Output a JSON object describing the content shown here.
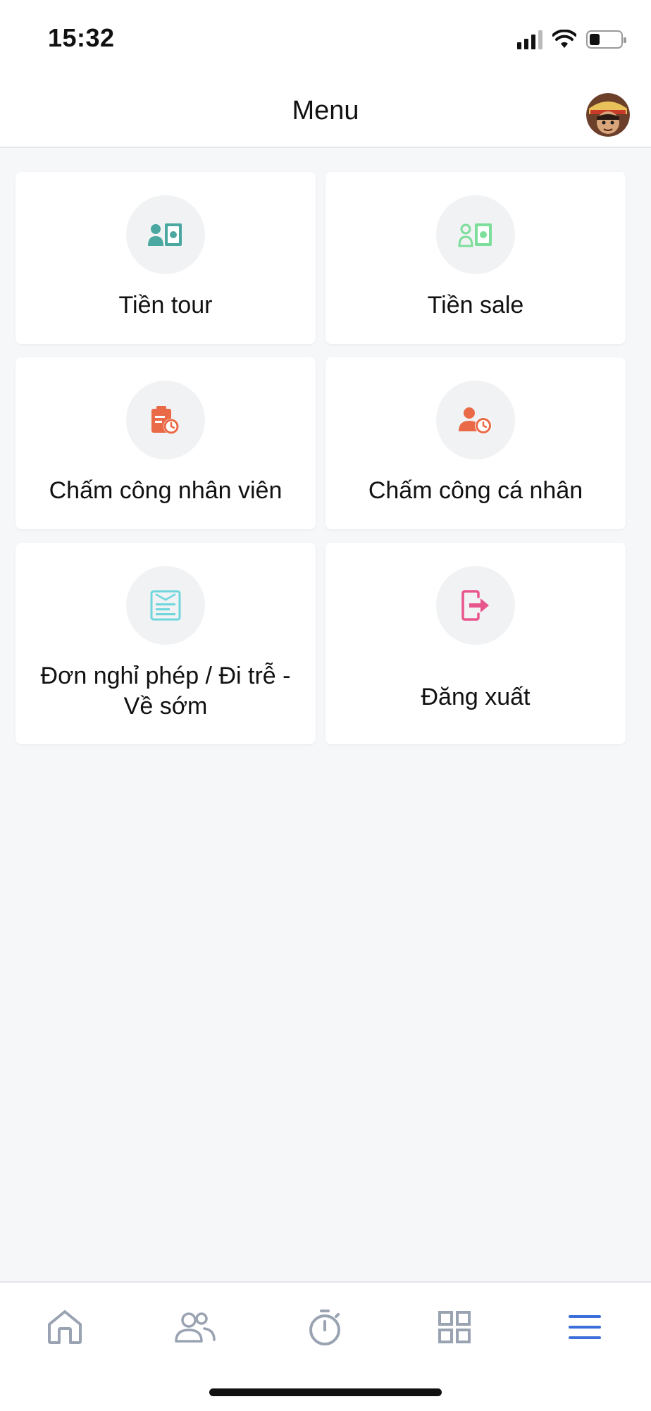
{
  "status_bar": {
    "time": "15:32"
  },
  "header": {
    "title": "Menu"
  },
  "menu": {
    "tien_tour": "Tiền tour",
    "tien_sale": "Tiền sale",
    "cham_cong_nhan_vien": "Chấm công nhân viên",
    "cham_cong_ca_nhan": "Chấm công cá nhân",
    "don_nghi_phep_line1": "Đơn nghỉ phép / Đi trễ -",
    "don_nghi_phep_line2": "Về sớm",
    "dang_xuat": "Đăng xuất"
  },
  "tabbar": {
    "items": [
      "home-icon",
      "people-icon",
      "stopwatch-icon",
      "grid-icon",
      "menu-icon"
    ],
    "active_index": 4
  },
  "colors": {
    "teal": "#4aa8a0",
    "green": "#7dde9b",
    "orange": "#ea6a47",
    "cyan": "#6fd6dc",
    "pink": "#e8558c",
    "tab_inactive": "#9aa3b2",
    "tab_active": "#3b6fd9"
  }
}
